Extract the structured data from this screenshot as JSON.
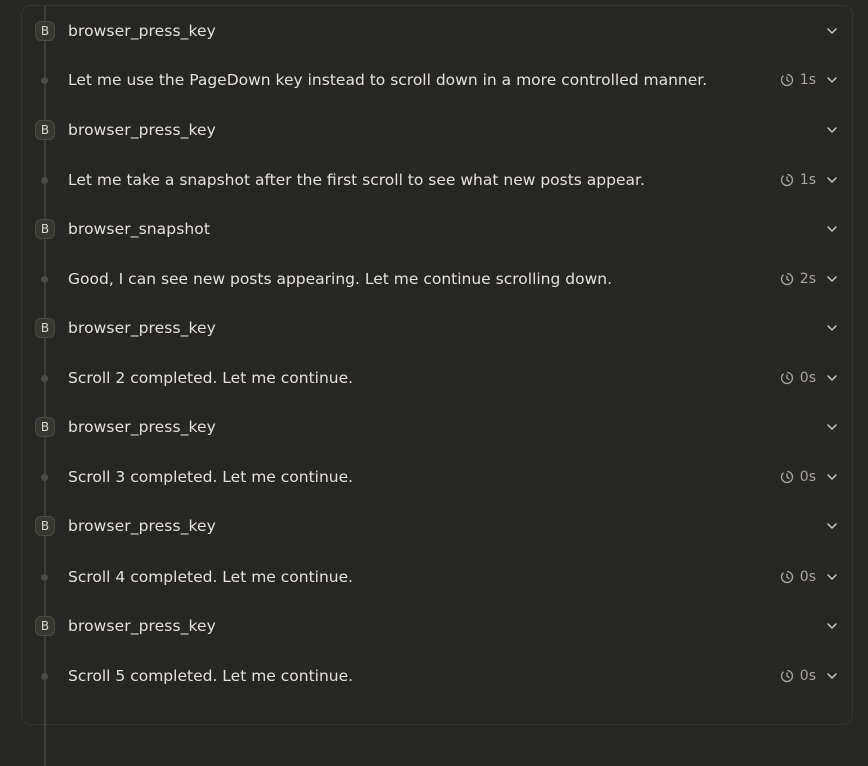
{
  "colors": {
    "background": "#262624",
    "text": "#e3e1d9",
    "muted": "#a7a59d",
    "timeline": "#3d3c37"
  },
  "steps": [
    {
      "type": "tool",
      "badge": "B",
      "label": "browser_press_key"
    },
    {
      "type": "thought",
      "label": "Let me use the PageDown key instead to scroll down in a more controlled manner.",
      "duration": "1s"
    },
    {
      "type": "tool",
      "badge": "B",
      "label": "browser_press_key"
    },
    {
      "type": "thought",
      "label": "Let me take a snapshot after the first scroll to see what new posts appear.",
      "duration": "1s"
    },
    {
      "type": "tool",
      "badge": "B",
      "label": "browser_snapshot"
    },
    {
      "type": "thought",
      "label": "Good, I can see new posts appearing. Let me continue scrolling down.",
      "duration": "2s"
    },
    {
      "type": "tool",
      "badge": "B",
      "label": "browser_press_key"
    },
    {
      "type": "thought",
      "label": "Scroll 2 completed. Let me continue.",
      "duration": "0s"
    },
    {
      "type": "tool",
      "badge": "B",
      "label": "browser_press_key"
    },
    {
      "type": "thought",
      "label": "Scroll 3 completed. Let me continue.",
      "duration": "0s"
    },
    {
      "type": "tool",
      "badge": "B",
      "label": "browser_press_key"
    },
    {
      "type": "thought",
      "label": "Scroll 4 completed. Let me continue.",
      "duration": "0s"
    },
    {
      "type": "tool",
      "badge": "B",
      "label": "browser_press_key"
    },
    {
      "type": "thought",
      "label": "Scroll 5 completed. Let me continue.",
      "duration": "0s"
    }
  ]
}
